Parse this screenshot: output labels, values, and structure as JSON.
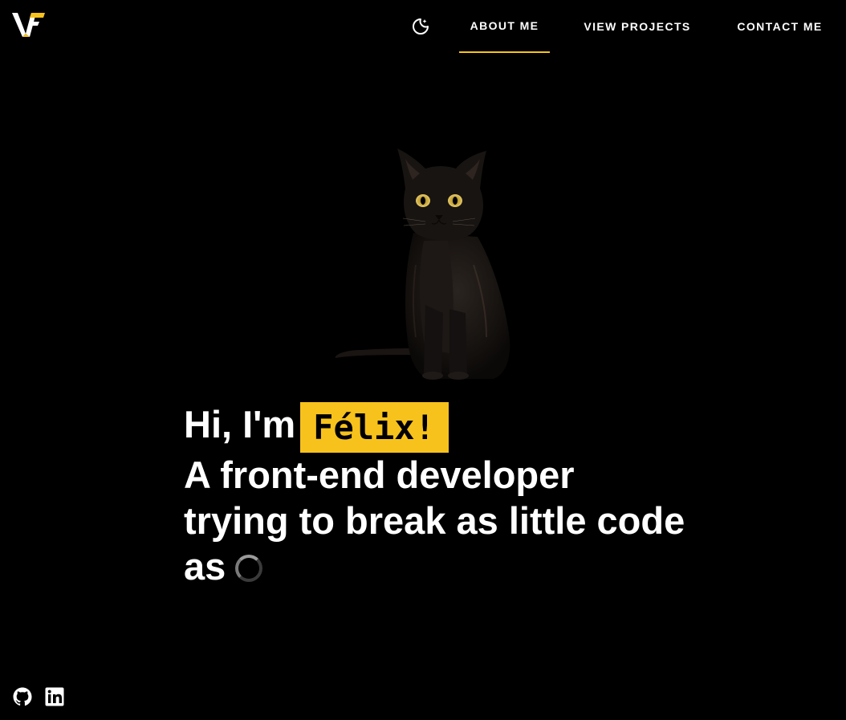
{
  "header": {
    "logo_name": "logo-icon",
    "theme_toggle_icon": "moon-icon",
    "nav": [
      {
        "label": "ABOUT ME",
        "active": true
      },
      {
        "label": "VIEW PROJECTS",
        "active": false
      },
      {
        "label": "CONTACT ME",
        "active": false
      }
    ]
  },
  "hero": {
    "greeting": "Hi, I'm",
    "name": "Félix!",
    "line2": "A front-end developer",
    "line3": "trying to break as little code",
    "line4": "as",
    "loader_icon": "spinner-icon"
  },
  "social": [
    {
      "icon": "github-icon"
    },
    {
      "icon": "linkedin-icon"
    }
  ],
  "colors": {
    "background": "#000000",
    "text": "#ffffff",
    "accent": "#f8c21c",
    "nav_underline": "#f5c518"
  }
}
